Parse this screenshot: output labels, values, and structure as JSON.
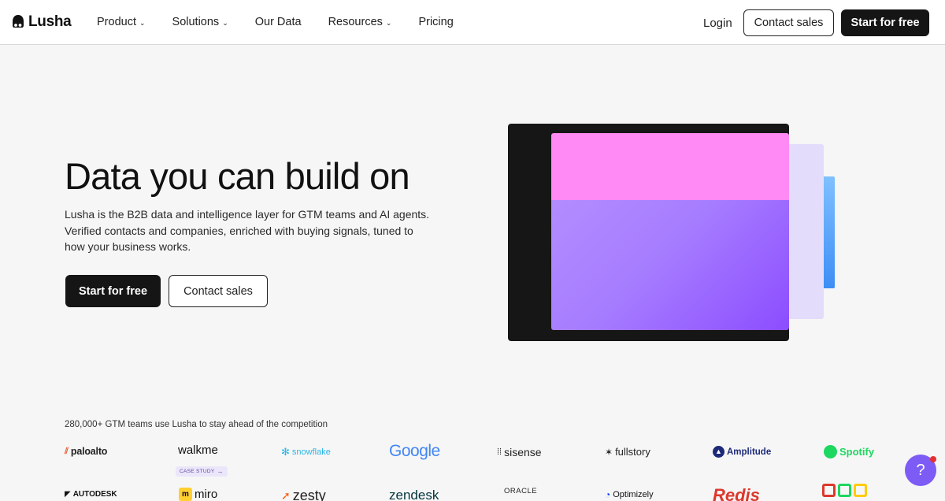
{
  "header": {
    "logo_text": "Lusha",
    "nav": [
      {
        "label": "Product",
        "has_menu": true
      },
      {
        "label": "Solutions",
        "has_menu": true
      },
      {
        "label": "Our Data",
        "has_menu": false
      },
      {
        "label": "Resources",
        "has_menu": true
      },
      {
        "label": "Pricing",
        "has_menu": false
      }
    ],
    "login": "Login",
    "contact_sales": "Contact sales",
    "start_free": "Start for free"
  },
  "hero": {
    "title": "Data you can build on",
    "subtitle": "Lusha is the B2B data and intelligence layer for GTM teams and AI agents. Verified contacts and companies, enriched with buying signals, tuned to how your business works.",
    "cta_primary": "Start for free",
    "cta_secondary": "Contact sales"
  },
  "trust": {
    "text": "280,000+ GTM teams use Lusha to stay ahead of the competition",
    "row1": [
      "paloalto",
      "walkme",
      "snowflake",
      "Google",
      "sisense",
      "fullstory",
      "Amplitude",
      "Spotify"
    ],
    "case_study": "CASE STUDY",
    "row2": [
      "AUTODESK",
      "miro",
      "zesty",
      "zendesk",
      "ORACLE",
      "Optimizely",
      "Redis",
      ""
    ]
  },
  "colors": {
    "accent": "#7d5bf5",
    "pink": "#ff8af5",
    "purple": "#a67cff",
    "dark": "#151515"
  }
}
